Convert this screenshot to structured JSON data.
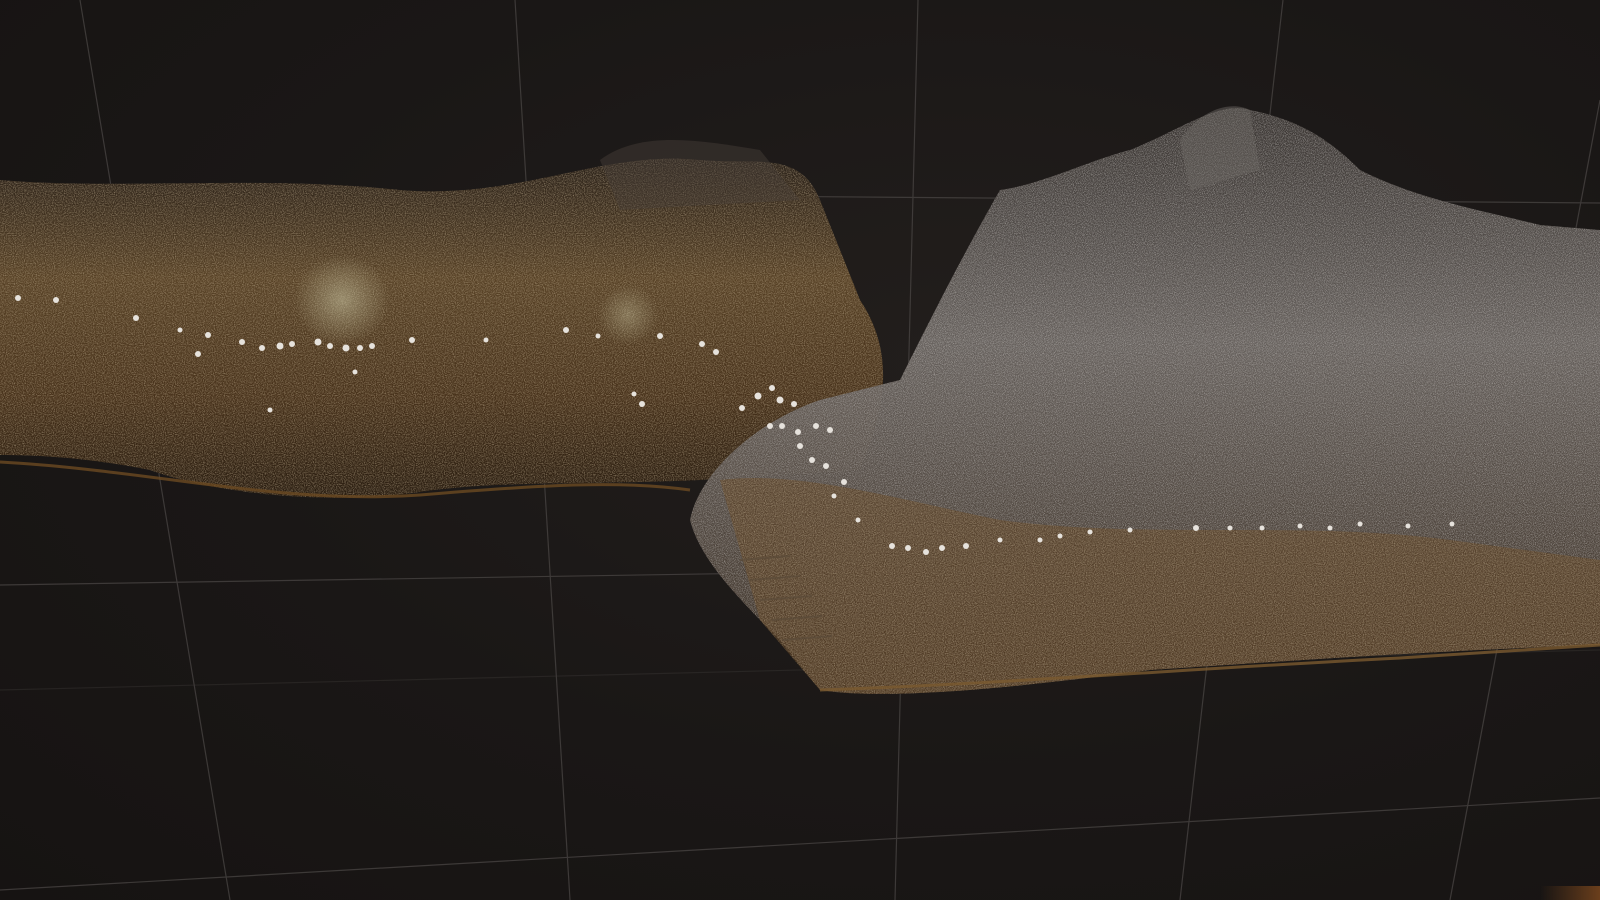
{
  "viewport": {
    "mode": "3d-point-cloud-view",
    "background_color": "#1b1817",
    "grid_color": "#4a4644",
    "colors": {
      "earth_dark": "#3b2a17",
      "earth_ochre": "#8a6a3a",
      "rock_grey": "#8e8985",
      "highlight": "#e6e2dc",
      "floor_edge": "#6b4a22"
    }
  }
}
